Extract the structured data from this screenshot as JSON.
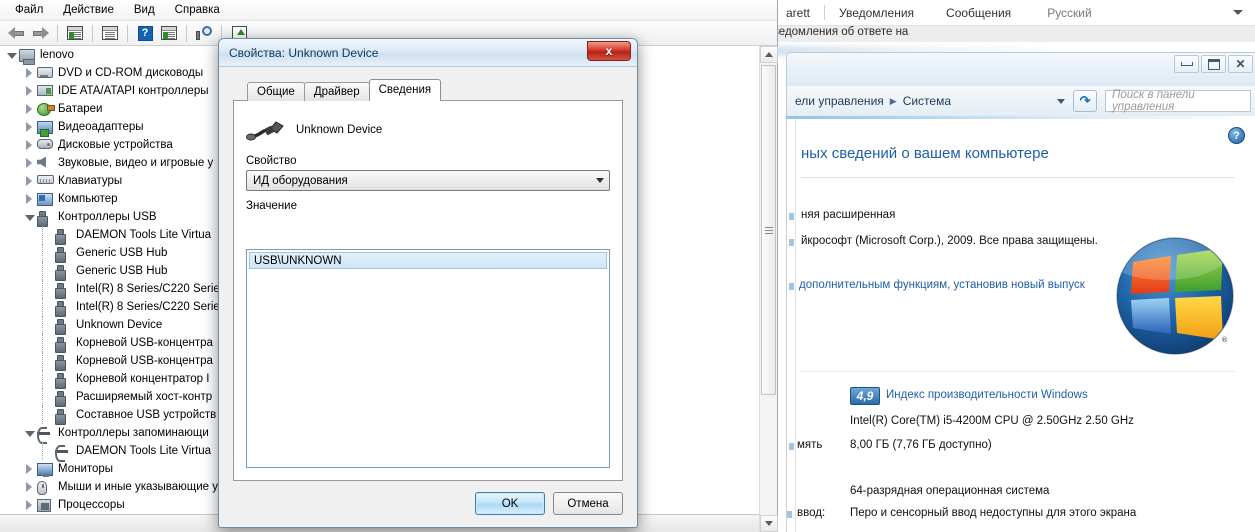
{
  "device_manager": {
    "menu": [
      "Файл",
      "Действие",
      "Вид",
      "Справка"
    ],
    "toolbar_icons": [
      "back-arrow",
      "forward-arrow",
      "properties-icon",
      "document-icon",
      "help-icon",
      "scan-play-icon",
      "scan-hardware-icon",
      "update-driver-icon"
    ],
    "tree": [
      {
        "label": "lenovo",
        "indent": 0,
        "expander": "open",
        "icon": "computer-icon"
      },
      {
        "label": "DVD и CD-ROM дисководы",
        "indent": 1,
        "expander": "closed",
        "icon": "dvd-icon"
      },
      {
        "label": "IDE ATA/ATAPI контроллеры",
        "indent": 1,
        "expander": "closed",
        "icon": "ide-icon"
      },
      {
        "label": "Батареи",
        "indent": 1,
        "expander": "closed",
        "icon": "battery-icon"
      },
      {
        "label": "Видеоадаптеры",
        "indent": 1,
        "expander": "closed",
        "icon": "video-icon"
      },
      {
        "label": "Дисковые устройства",
        "indent": 1,
        "expander": "closed",
        "icon": "disk-icon"
      },
      {
        "label": "Звуковые, видео и игровые у",
        "indent": 1,
        "expander": "closed",
        "icon": "sound-icon"
      },
      {
        "label": "Клавиатуры",
        "indent": 1,
        "expander": "closed",
        "icon": "keyboard-icon"
      },
      {
        "label": "Компьютер",
        "indent": 1,
        "expander": "closed",
        "icon": "pc-icon"
      },
      {
        "label": "Контроллеры USB",
        "indent": 1,
        "expander": "open",
        "icon": "usb-icon"
      },
      {
        "label": "DAEMON Tools Lite Virtua",
        "indent": 2,
        "expander": "none",
        "icon": "usb-icon"
      },
      {
        "label": "Generic USB Hub",
        "indent": 2,
        "expander": "none",
        "icon": "usb-icon"
      },
      {
        "label": "Generic USB Hub",
        "indent": 2,
        "expander": "none",
        "icon": "usb-icon"
      },
      {
        "label": "Intel(R) 8 Series/C220 Serie",
        "indent": 2,
        "expander": "none",
        "icon": "usb-icon"
      },
      {
        "label": "Intel(R) 8 Series/C220 Serie",
        "indent": 2,
        "expander": "none",
        "icon": "usb-icon"
      },
      {
        "label": "Unknown Device",
        "indent": 2,
        "expander": "none",
        "icon": "usb-icon"
      },
      {
        "label": "Корневой USB-концентра",
        "indent": 2,
        "expander": "none",
        "icon": "usb-icon"
      },
      {
        "label": "Корневой USB-концентра",
        "indent": 2,
        "expander": "none",
        "icon": "usb-icon"
      },
      {
        "label": "Корневой концентратор I",
        "indent": 2,
        "expander": "none",
        "icon": "usb-icon"
      },
      {
        "label": "Расширяемый хост-контр",
        "indent": 2,
        "expander": "none",
        "icon": "usb-icon"
      },
      {
        "label": "Составное USB устройств",
        "indent": 2,
        "expander": "none",
        "icon": "usb-icon"
      },
      {
        "label": "Контроллеры запоминающи",
        "indent": 1,
        "expander": "open",
        "icon": "storage-icon"
      },
      {
        "label": "DAEMON Tools Lite Virtua",
        "indent": 2,
        "expander": "none",
        "icon": "storage-icon"
      },
      {
        "label": "Мониторы",
        "indent": 1,
        "expander": "closed",
        "icon": "monitor-icon"
      },
      {
        "label": "Мыши и иные указывающие ус",
        "indent": 1,
        "expander": "closed",
        "icon": "mouse-icon"
      },
      {
        "label": "Процессоры",
        "indent": 1,
        "expander": "closed",
        "icon": "cpu-icon"
      }
    ]
  },
  "dialog": {
    "title": "Свойства: Unknown Device",
    "close_label": "x",
    "tabs": [
      {
        "label": "Общие",
        "active": false
      },
      {
        "label": "Драйвер",
        "active": false
      },
      {
        "label": "Сведения",
        "active": true
      }
    ],
    "device_name": "Unknown Device",
    "property_label": "Свойство",
    "property_value": "ИД оборудования",
    "value_label": "Значение",
    "values": [
      "USB\\UNKNOWN"
    ],
    "ok_label": "OK",
    "cancel_label": "Отмена"
  },
  "browser": {
    "user": "arett",
    "links": [
      "Уведомления",
      "Сообщения"
    ],
    "language": "Русский",
    "notification_checkbox": "Отправить мне уведомления об ответе на"
  },
  "control_panel": {
    "window_buttons": [
      "minimize-button",
      "restore-button",
      "close-button"
    ],
    "breadcrumb_prefix": "ели управления",
    "breadcrumb_current": "Система",
    "refresh_icon": "refresh-icon",
    "search_placeholder": "Поиск в панели управления",
    "help_icon": "help-icon",
    "heading": "ных сведений о вашем компьютере",
    "edition_line": "няя расширенная",
    "copyright_line": "йкрософт (Microsoft Corp.), 2009. Все права защищены.",
    "upgrade_link": "дополнительным функциям, установив новый выпуск",
    "wei_score": "4,9",
    "wei_label": "Индекс производительности Windows",
    "processor": "Intel(R) Core(TM) i5-4200M CPU @ 2.50GHz   2.50 GHz",
    "memory_label": "мять",
    "memory_value": "8,00 ГБ (7,76 ГБ доступно)",
    "system_type": "64-разрядная операционная система",
    "pen_label": "ввод:",
    "pen_value": "Перо и сенсорный ввод недоступны для этого экрана"
  }
}
